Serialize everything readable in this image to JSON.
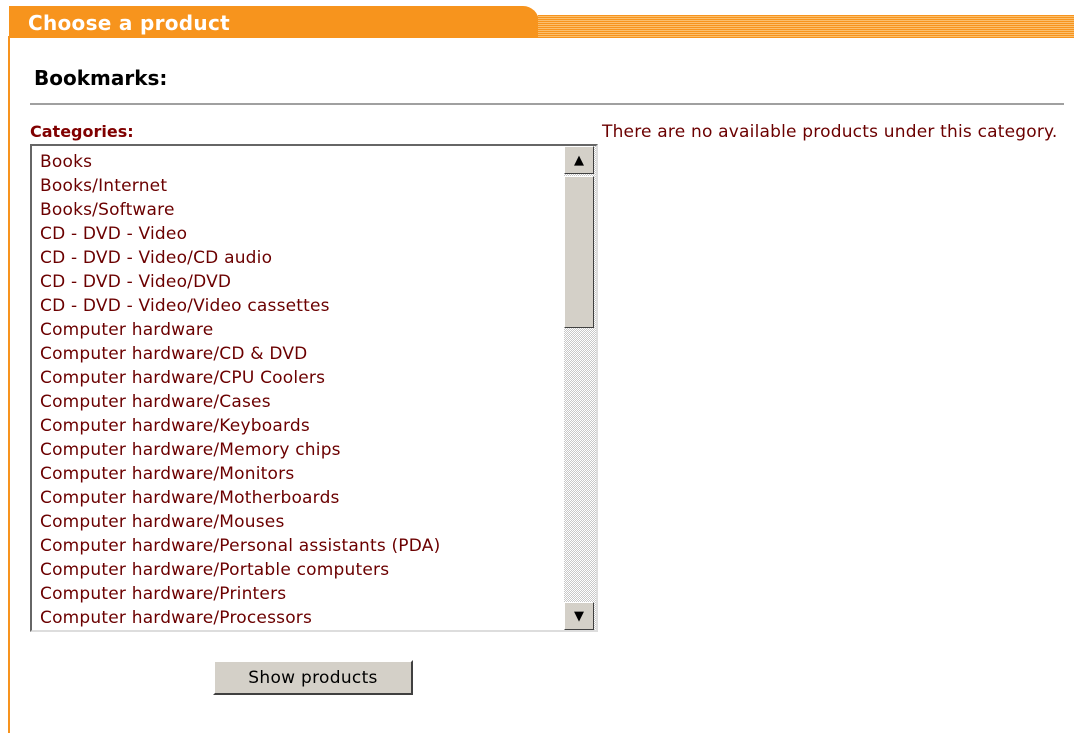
{
  "header": {
    "title": "Choose a product"
  },
  "bookmarks": {
    "label": "Bookmarks:"
  },
  "categories": {
    "label": "Categories:",
    "items": [
      "Books",
      "Books/Internet",
      "Books/Software",
      "CD - DVD - Video",
      "CD - DVD - Video/CD audio",
      "CD - DVD - Video/DVD",
      "CD - DVD - Video/Video cassettes",
      "Computer hardware",
      "Computer hardware/CD & DVD",
      "Computer hardware/CPU Coolers",
      "Computer hardware/Cases",
      "Computer hardware/Keyboards",
      "Computer hardware/Memory chips",
      "Computer hardware/Monitors",
      "Computer hardware/Motherboards",
      "Computer hardware/Mouses",
      "Computer hardware/Personal assistants (PDA)",
      "Computer hardware/Portable computers",
      "Computer hardware/Printers",
      "Computer hardware/Processors"
    ]
  },
  "message": {
    "no_products": "There are no available products under this category."
  },
  "actions": {
    "show_products": "Show products"
  },
  "colors": {
    "accent": "#f7941d",
    "text": "#6b0000"
  },
  "icons": {
    "scroll_up": "triangle-up-icon",
    "scroll_down": "triangle-down-icon"
  }
}
